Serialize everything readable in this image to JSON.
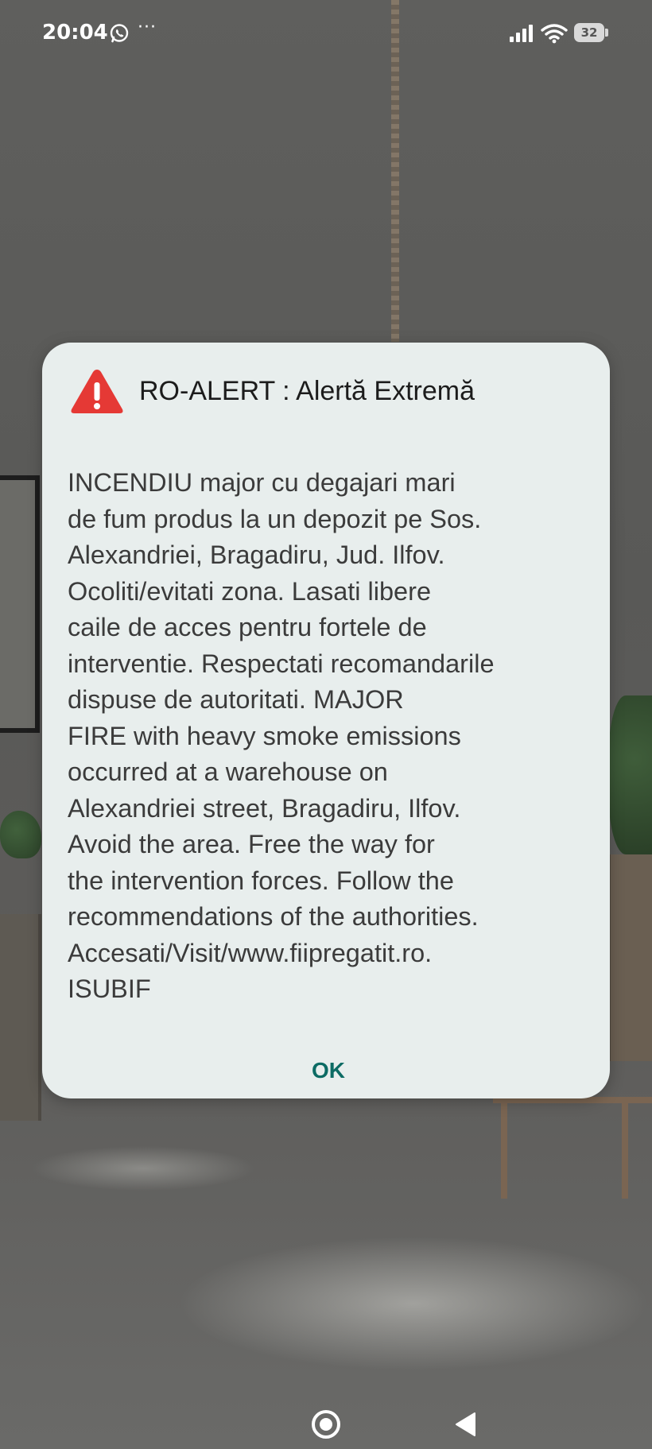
{
  "status_bar": {
    "time": "20:04",
    "more": "···",
    "battery": "32",
    "icons": [
      "whatsapp-icon",
      "signal-icon",
      "wifi-icon",
      "battery-icon"
    ]
  },
  "dialog": {
    "icon": "warning-icon",
    "title": "RO-ALERT : Alertă Extremă",
    "body_lines": [
      "INCENDIU major cu degajari mari",
      "de fum produs la un depozit pe Sos.",
      "Alexandriei, Bragadiru, Jud. Ilfov.",
      "Ocoliti/evitati zona. Lasati libere",
      "caile de acces pentru fortele de",
      "interventie. Respectati recomandarile",
      "dispuse de autoritati. MAJOR",
      "FIRE with heavy smoke emissions",
      "occurred at a warehouse on",
      "Alexandriei street, Bragadiru, Ilfov.",
      "Avoid the area. Free the way for",
      "the intervention forces. Follow the",
      "recommendations of the authorities.",
      "Accesati/Visit/www.fiipregatit.ro.",
      "ISUBIF"
    ],
    "ok_label": "OK"
  },
  "colors": {
    "alert_red": "#e53935",
    "ok_teal": "#0c6b64",
    "dialog_bg": "#e8eeed"
  },
  "nav_bar": {
    "icons": [
      "home-icon",
      "back-icon"
    ]
  }
}
